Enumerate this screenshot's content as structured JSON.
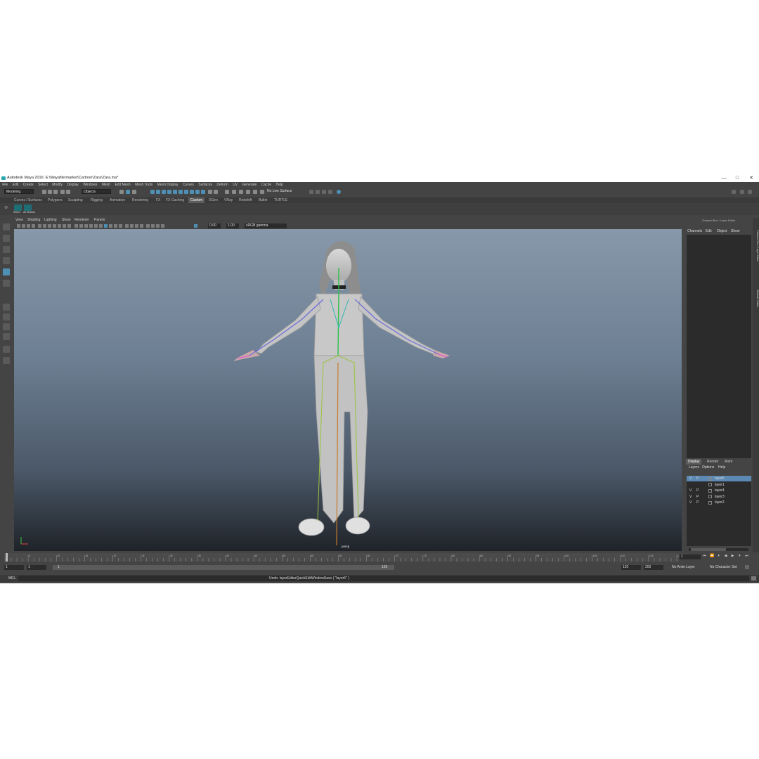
{
  "window": {
    "title": "Autodesk Maya 2016: E:\\Mayafile\\market\\Cartoon\\Zara\\Zara.ma*",
    "controls": [
      "—",
      "□",
      "✕"
    ]
  },
  "menubar": [
    "File",
    "Edit",
    "Create",
    "Select",
    "Modify",
    "Display",
    "Windows",
    "Mesh",
    "Edit Mesh",
    "Mesh Tools",
    "Mesh Display",
    "Curves",
    "Surfaces",
    "Deform",
    "UV",
    "Generate",
    "Cache",
    "Help"
  ],
  "statusline": {
    "menu_set": "Modeling",
    "selection_mode": "Objects",
    "live_surface": "No Live Surface"
  },
  "shelf": {
    "tabs": [
      "Curves / Surfaces",
      "Polygons",
      "Sculpting",
      "Rigging",
      "Animation",
      "Rendering",
      "FX",
      "FX Caching",
      "Custom",
      "XGen",
      "VRay",
      "Redshift",
      "Bullet",
      "TURTLE"
    ],
    "active_tab": "Custom",
    "buttons": [
      "Select",
      "All Meshes"
    ]
  },
  "panel": {
    "menus": [
      "View",
      "Shading",
      "Lighting",
      "Show",
      "Renderer",
      "Panels"
    ],
    "exposure": "0.00",
    "gamma": "1.00",
    "color_space": "sRGB gamma",
    "camera_label": "persp"
  },
  "channel_box": {
    "header": "Channel Box / Layer Editor",
    "menus": [
      "Channels",
      "Edit",
      "Object",
      "Show"
    ]
  },
  "layer_editor": {
    "tabs": [
      "Display",
      "Render",
      "Anim"
    ],
    "active_tab": "Display",
    "menus": [
      "Layers",
      "Options",
      "Help"
    ],
    "layers": [
      {
        "v": "V",
        "p": "P",
        "name": "layer5",
        "selected": true
      },
      {
        "v": "",
        "p": "",
        "name": "layer1",
        "selected": false
      },
      {
        "v": "V",
        "p": "P",
        "name": "layer4",
        "selected": false
      },
      {
        "v": "V",
        "p": "P",
        "name": "layer3",
        "selected": false
      },
      {
        "v": "V",
        "p": "P",
        "name": "layer2",
        "selected": false
      }
    ]
  },
  "side_tabs": [
    "Channel Box / Layer Editor",
    "Attribute Editor"
  ],
  "timeline": {
    "current_frame": "1",
    "ticks": [
      "1",
      "5",
      "10",
      "15",
      "20",
      "25",
      "30",
      "35",
      "40",
      "45",
      "50",
      "55",
      "60",
      "65",
      "70",
      "75",
      "80",
      "85",
      "90",
      "95",
      "100",
      "105",
      "110",
      "115",
      "120"
    ]
  },
  "range": {
    "start": "1",
    "playback_start": "1",
    "range_start_label": "1",
    "range_end_label": "120",
    "playback_end": "120",
    "end": "200",
    "anim_layer": "No Anim Layer",
    "character_set": "No Character Set"
  },
  "command_line": {
    "label": "MEL",
    "message": "Undo: layerEditorQuickEditWindowSave ( \"layer5\" )"
  },
  "colors": {
    "ui_bg": "#444444",
    "accent": "#4f8fb3",
    "viewport_top": "#8798aa",
    "viewport_bottom": "#1f2329"
  }
}
